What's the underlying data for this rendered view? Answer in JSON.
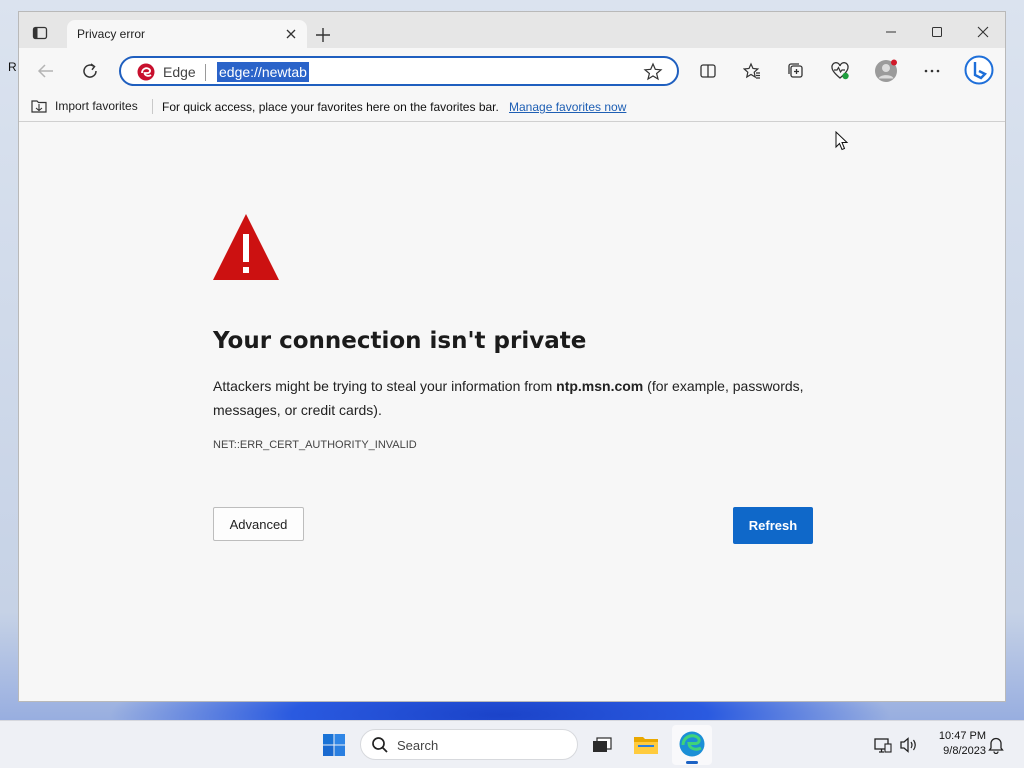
{
  "desktop": {
    "edge_letter": "R"
  },
  "tab": {
    "title": "Privacy error",
    "close_label": "×",
    "new_tab_label": "+"
  },
  "toolbar": {
    "omnibox_label": "Edge",
    "url": "edge://newtab"
  },
  "favorites_bar": {
    "import_label": "Import favorites",
    "hint": "For quick access, place your favorites here on the favorites bar.",
    "manage_link": "Manage favorites now"
  },
  "error_page": {
    "heading": "Your connection isn't private",
    "desc_before": "Attackers might be trying to steal your information from ",
    "domain": "ntp.msn.com",
    "desc_after": " (for example, passwords, messages, or credit cards).",
    "error_code": "NET::ERR_CERT_AUTHORITY_INVALID",
    "advanced_label": "Advanced",
    "refresh_label": "Refresh"
  },
  "taskbar": {
    "search_label": "Search",
    "time": "10:47 PM",
    "date": "9/8/2023"
  },
  "colors": {
    "accent": "#0f68c9",
    "warning": "#cc1111",
    "link": "#1e5fb4"
  },
  "icons": [
    "tab-actions-icon",
    "close-icon",
    "plus-icon",
    "minimize-icon",
    "maximize-icon",
    "window-close-icon",
    "back-arrow-icon",
    "refresh-icon",
    "edge-logo-icon",
    "star-icon",
    "split-screen-icon",
    "favorites-icon",
    "collections-icon",
    "browser-essentials-icon",
    "profile-icon",
    "more-icon",
    "bing-copilot-icon",
    "import-favorites-icon",
    "warning-triangle-icon",
    "windows-start-icon",
    "search-icon",
    "task-view-icon",
    "file-explorer-icon",
    "edge-taskbar-icon",
    "network-icon",
    "volume-icon",
    "notification-bell-icon",
    "mouse-cursor-icon"
  ]
}
